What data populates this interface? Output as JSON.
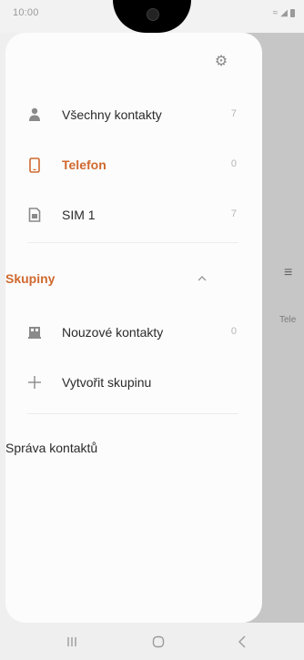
{
  "status_bar": {
    "time": "10:00"
  },
  "drawer": {
    "items": [
      {
        "label": "Všechny kontakty",
        "count": "7",
        "icon": "person-icon",
        "active": false
      },
      {
        "label": "Telefon",
        "count": "0",
        "icon": "phone-icon",
        "active": true
      },
      {
        "label": "SIM 1",
        "count": "7",
        "icon": "sim-card-icon",
        "active": false
      }
    ],
    "groups_title": "Skupiny",
    "groups": [
      {
        "label": "Nouzové kontakty",
        "count": "0",
        "icon": "emergency-icon"
      },
      {
        "label": "Vytvořit skupinu",
        "icon": "plus-icon"
      }
    ],
    "manage_label": "Správa kontaktů"
  },
  "background": {
    "partial_text": "Tele"
  },
  "colors": {
    "accent": "#d0692f",
    "drawer_bg": "#fcfcfc",
    "backdrop": "#c6c6c6"
  }
}
